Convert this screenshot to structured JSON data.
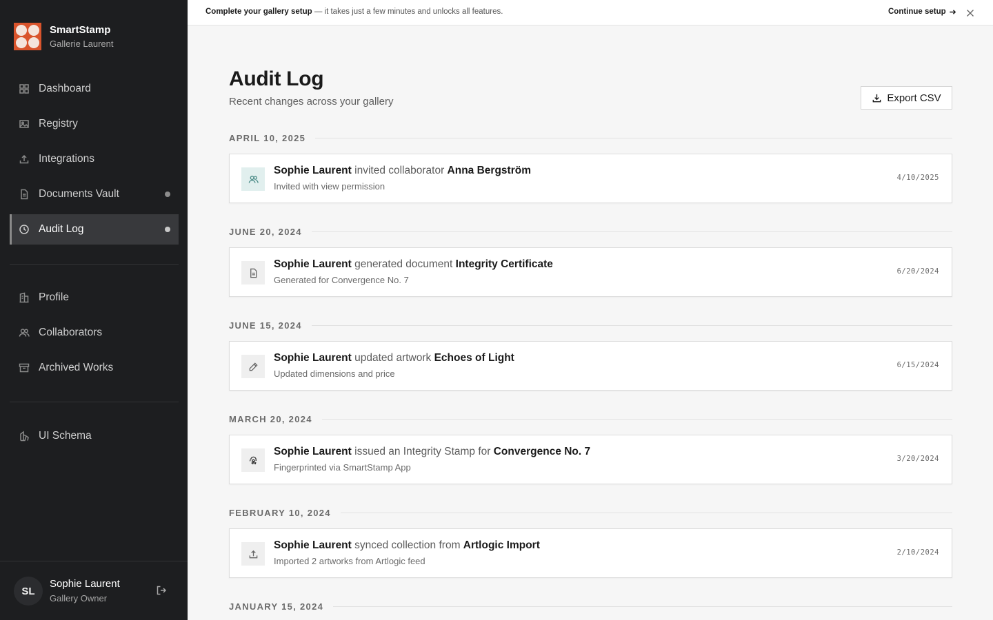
{
  "brand": {
    "name": "SmartStamp",
    "org": "Gallerie Laurent"
  },
  "nav_primary": [
    {
      "label": "Dashboard",
      "icon": "grid-icon"
    },
    {
      "label": "Registry",
      "icon": "image-icon"
    },
    {
      "label": "Integrations",
      "icon": "upload-icon"
    },
    {
      "label": "Documents Vault",
      "icon": "document-icon",
      "dot": true
    },
    {
      "label": "Audit Log",
      "icon": "clock-icon",
      "dot": true,
      "active": true
    }
  ],
  "nav_secondary": [
    {
      "label": "Profile",
      "icon": "building-icon"
    },
    {
      "label": "Collaborators",
      "icon": "users-icon"
    },
    {
      "label": "Archived Works",
      "icon": "archive-icon"
    }
  ],
  "nav_tertiary": [
    {
      "label": "UI Schema",
      "icon": "brush-icon"
    }
  ],
  "user": {
    "initials": "SL",
    "name": "Sophie Laurent",
    "role": "Gallery Owner"
  },
  "banner": {
    "strong": "Complete your gallery setup",
    "text": " — it takes just a few minutes and unlocks all features.",
    "cta": "Continue setup"
  },
  "page": {
    "title": "Audit Log",
    "subtitle": "Recent changes across your gallery",
    "export_label": "Export CSV"
  },
  "groups": [
    {
      "label": "APRIL 10, 2025",
      "entries": [
        {
          "icon": "users-icon",
          "actor": "Sophie Laurent",
          "action": " invited collaborator ",
          "target": "Anna Bergström",
          "detail": "Invited with view permission",
          "date": "4/10/2025"
        }
      ]
    },
    {
      "label": "JUNE 20, 2024",
      "entries": [
        {
          "icon": "document-icon",
          "actor": "Sophie Laurent",
          "action": " generated document ",
          "target": "Integrity Certificate",
          "detail": "Generated for Convergence No. 7",
          "date": "6/20/2024"
        }
      ]
    },
    {
      "label": "JUNE 15, 2024",
      "entries": [
        {
          "icon": "pencil-icon",
          "actor": "Sophie Laurent",
          "action": " updated artwork ",
          "target": "Echoes of Light",
          "detail": "Updated dimensions and price",
          "date": "6/15/2024"
        }
      ]
    },
    {
      "label": "MARCH 20, 2024",
      "entries": [
        {
          "icon": "fingerprint-icon",
          "actor": "Sophie Laurent",
          "action": " issued an Integrity Stamp for ",
          "target": "Convergence No. 7",
          "detail": "Fingerprinted via SmartStamp App",
          "date": "3/20/2024"
        }
      ]
    },
    {
      "label": "FEBRUARY 10, 2024",
      "entries": [
        {
          "icon": "upload-icon",
          "actor": "Sophie Laurent",
          "action": " synced collection from ",
          "target": "Artlogic Import",
          "detail": "Imported 2 artworks from Artlogic feed",
          "date": "2/10/2024"
        }
      ]
    },
    {
      "label": "JANUARY 15, 2024",
      "entries": []
    }
  ]
}
